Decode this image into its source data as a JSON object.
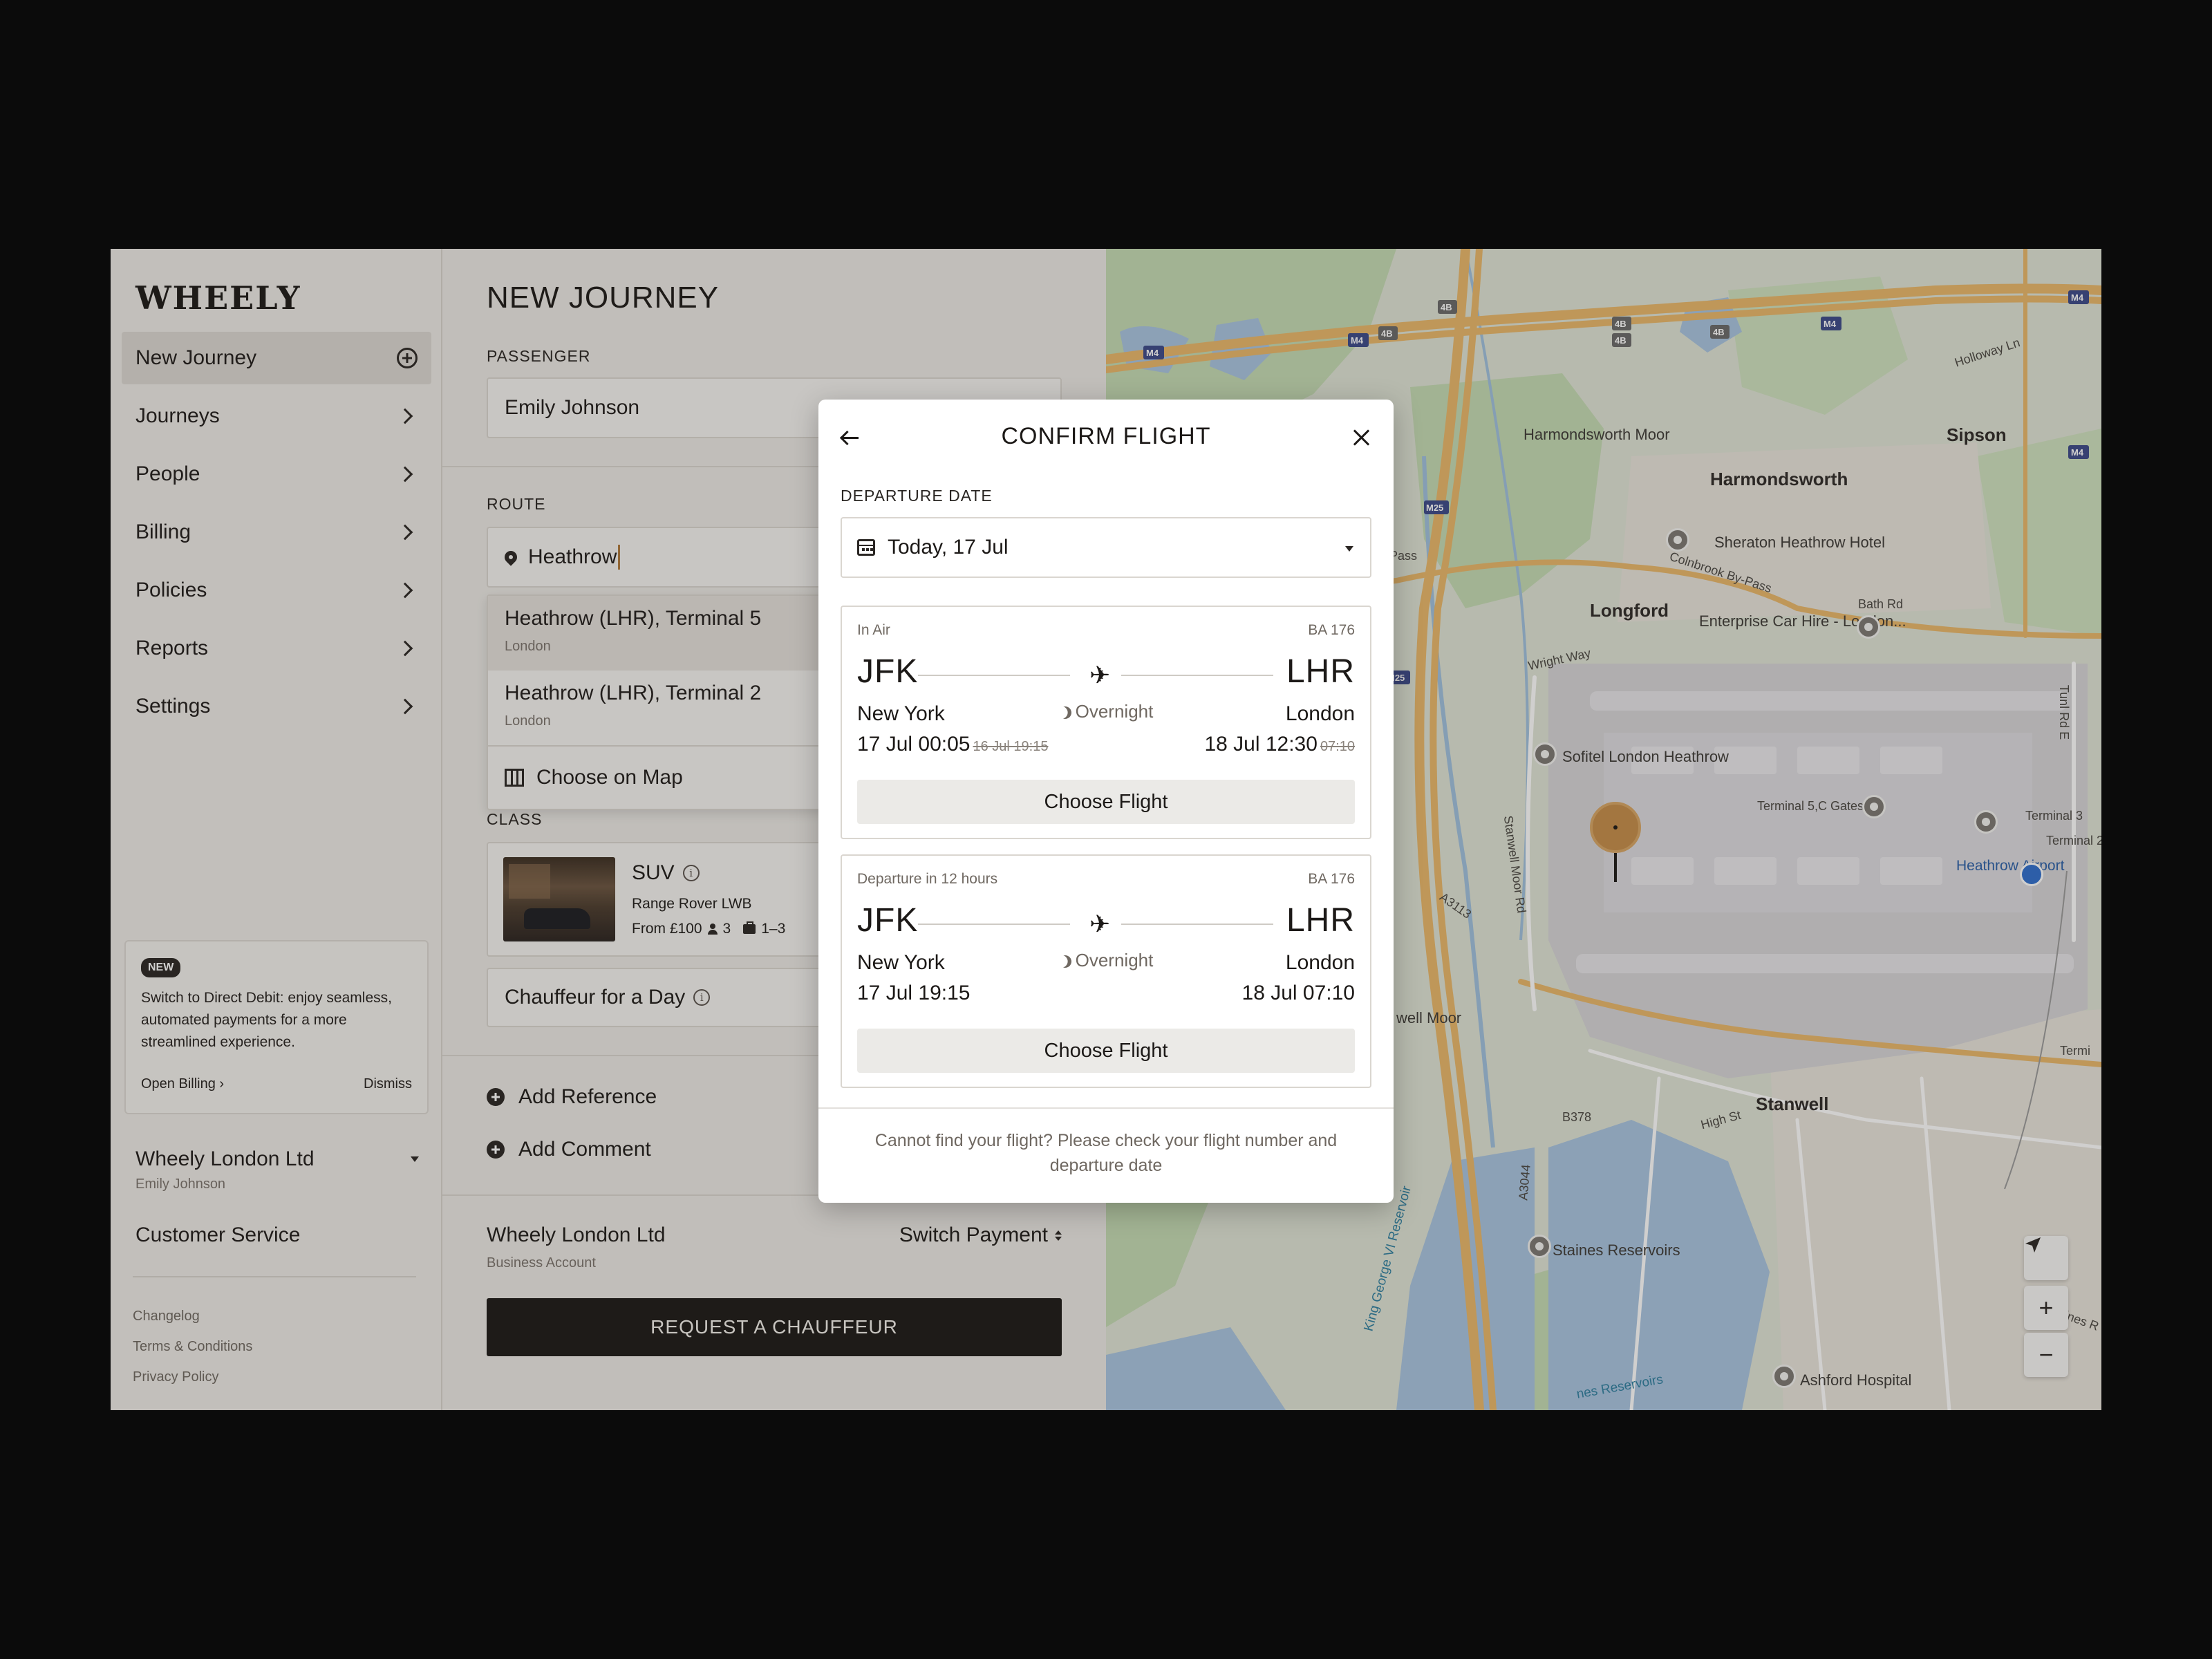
{
  "sidebar": {
    "logo": "WHEELY",
    "items": [
      {
        "label": "New Journey"
      },
      {
        "label": "Journeys"
      },
      {
        "label": "People"
      },
      {
        "label": "Billing"
      },
      {
        "label": "Policies"
      },
      {
        "label": "Reports"
      },
      {
        "label": "Settings"
      }
    ],
    "promo": {
      "badge": "NEW",
      "text": "Switch to Direct Debit: enjoy seamless, automated payments for a more streamlined experience.",
      "open_billing": "Open Billing ›",
      "dismiss": "Dismiss"
    },
    "org": {
      "name": "Wheely London Ltd",
      "user": "Emily Johnson"
    },
    "customer_service": "Customer Service",
    "footer": {
      "changelog": "Changelog",
      "terms": "Terms & Conditions",
      "privacy": "Privacy Policy"
    }
  },
  "form": {
    "title": "NEW JOURNEY",
    "passenger_label": "PASSENGER",
    "passenger_value": "Emily Johnson",
    "route_label": "ROUTE",
    "route_value": "Heathrow",
    "suggestions": [
      {
        "title": "Heathrow (LHR), Terminal 5",
        "sub": "London"
      },
      {
        "title": "Heathrow (LHR), Terminal 2",
        "sub": "London"
      }
    ],
    "choose_on_map": "Choose on Map",
    "class_label": "CLASS",
    "class_card": {
      "name": "SUV",
      "model": "Range Rover LWB",
      "price": "From £100",
      "passengers": "3",
      "luggage": "1–3"
    },
    "chauffeur_day": "Chauffeur for a Day",
    "add_reference": "Add Reference",
    "add_comment": "Add Comment",
    "payment": {
      "name": "Wheely London Ltd",
      "sub": "Business Account",
      "switch": "Switch Payment"
    },
    "request_button": "REQUEST A CHAUFFEUR"
  },
  "modal": {
    "title": "CONFIRM FLIGHT",
    "departure_label": "DEPARTURE DATE",
    "departure_value": "Today, 17 Jul",
    "flights": [
      {
        "status": "In Air",
        "number": "BA 176",
        "from_code": "JFK",
        "to_code": "LHR",
        "from_city": "New York",
        "to_city": "London",
        "overnight": "Overnight",
        "dep_time": "17 Jul 00:05",
        "dep_orig": "16 Jul 19:15",
        "arr_time": "18 Jul 12:30",
        "arr_orig": "07:10",
        "button": "Choose Flight"
      },
      {
        "status": "Departure in 12 hours",
        "number": "BA 176",
        "from_code": "JFK",
        "to_code": "LHR",
        "from_city": "New York",
        "to_city": "London",
        "overnight": "Overnight",
        "dep_time": "17 Jul 19:15",
        "dep_orig": "",
        "arr_time": "18 Jul 07:10",
        "arr_orig": "",
        "button": "Choose Flight"
      }
    ],
    "footer": "Cannot find your flight? Please check your flight number and departure date"
  },
  "map": {
    "labels": {
      "harmondsworth_moor": "Harmondsworth Moor",
      "harmondsworth": "Harmondsworth",
      "sipson": "Sipson",
      "sheraton": "Sheraton Heathrow Hotel",
      "colnbrook": "Colnbrook By-Pass",
      "bath_rd": "Bath Rd",
      "longford": "Longford",
      "enterprise": "Enterprise Car Hire - London...",
      "wright_way": "Wright Way",
      "sofitel": "Sofitel London Heathrow",
      "terminal5c": "Terminal 5,C Gates",
      "terminal3": "Terminal 3",
      "terminal2": "Terminal 2",
      "heathrow_airport": "Heathrow Airport",
      "stanwell_moor_rd": "Stanwell Moor Rd",
      "a3113": "A3113",
      "well_moor": "well Moor",
      "stanwell": "Stanwell",
      "high_st": "High St",
      "b378": "B378",
      "a3044": "A3044",
      "staines_res": "Staines Reservoirs",
      "king_george": "King George VI Reservoir",
      "ashford": "Ashford Hospital",
      "holloway": "Holloway Ln",
      "pass": "Pass",
      "tunl_rd": "Tunl Rd E",
      "termi": "Termi",
      "lines_r": "lines R",
      "res_bottom": "nes Reservoirs",
      "m4": "M4",
      "m25": "M25",
      "b4": "4B"
    },
    "colors": {
      "water": "#a8c4e0",
      "park": "#c5dcb4",
      "airport": "#d6d5d8",
      "road_major": "#e9b86a"
    }
  }
}
